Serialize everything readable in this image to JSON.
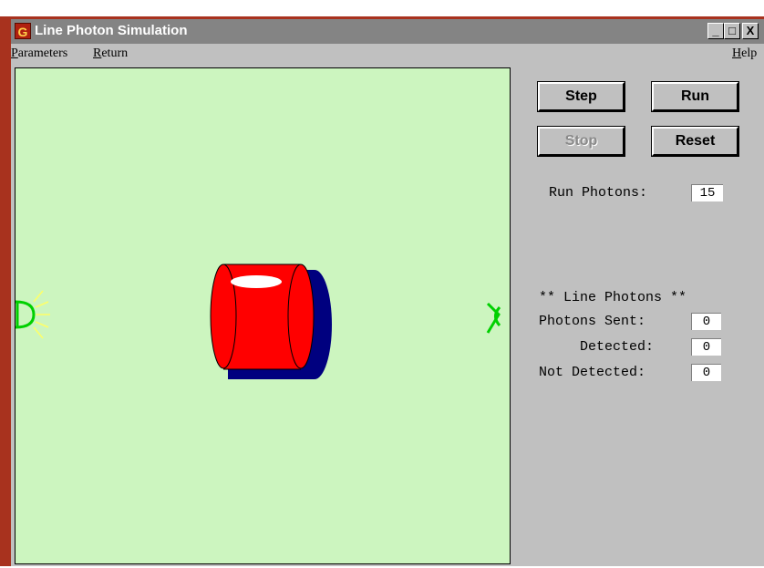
{
  "window": {
    "title": "Line Photon Simulation",
    "controls": {
      "minimize": "_",
      "maximize": "□",
      "close": "X"
    }
  },
  "menu": {
    "parameters_first": "P",
    "parameters_rest": "arameters",
    "return_first": "R",
    "return_rest": "eturn",
    "help_first": "H",
    "help_rest": "elp"
  },
  "buttons": {
    "step": "Step",
    "run": "Run",
    "stop": "Stop",
    "reset": "Reset"
  },
  "run_photons": {
    "label": "Run Photons:",
    "value": "15"
  },
  "stats": {
    "header": "** Line Photons **",
    "sent_label": "Photons Sent:",
    "sent_value": "0",
    "detected_label": "Detected:",
    "detected_value": "0",
    "not_detected_label": "Not Detected:",
    "not_detected_value": "0"
  },
  "colors": {
    "canvas_bg": "#ccf5bf",
    "cylinder_front": "#ff0000",
    "cylinder_shadow": "#00007f",
    "source": "#00d000",
    "rays": "#ffff66",
    "detector": "#00d000",
    "frame": "#a8321e"
  },
  "icons": {
    "app": "app-logo-icon",
    "source": "light-source-icon",
    "detector": "eye-detector-icon"
  }
}
